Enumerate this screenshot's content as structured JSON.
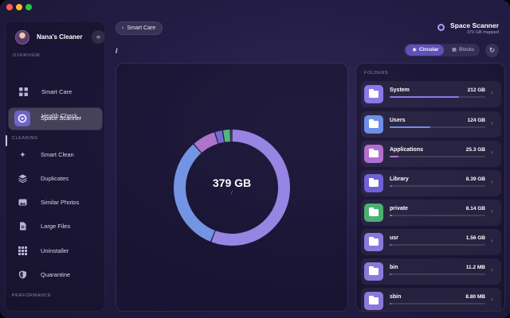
{
  "app": {
    "user_name": "Nana's Cleaner"
  },
  "sidebar": {
    "sections": [
      "OVERVIEW",
      "CLEANING",
      "PERFORMANCE"
    ],
    "items": [
      {
        "label": "Smart Care",
        "icon": "grid-icon"
      },
      {
        "label": "Health Check",
        "icon": "heart-pulse-icon"
      },
      {
        "label": "Space Scanner",
        "icon": "disk-icon",
        "active": true
      },
      {
        "label": "Smart Clean",
        "icon": "sparkle-icon"
      },
      {
        "label": "Duplicates",
        "icon": "stack-icon"
      },
      {
        "label": "Similar Photos",
        "icon": "photos-icon"
      },
      {
        "label": "Large Files",
        "icon": "file-icon"
      },
      {
        "label": "Uninstaller",
        "icon": "apps-grid-icon"
      },
      {
        "label": "Quarantine",
        "icon": "shield-icon"
      }
    ]
  },
  "header": {
    "back_label": "Smart Care",
    "path": "/",
    "title": "Space Scanner",
    "subtitle": "379 GB mapped",
    "view_options": [
      "Circular",
      "Blocks"
    ],
    "selected_view": "Circular"
  },
  "chart": {
    "total": "379 GB",
    "path": "/"
  },
  "chart_data": {
    "type": "pie",
    "categories": [
      "System",
      "Users",
      "Applications",
      "Library",
      "private",
      "usr",
      "bin",
      "sbin"
    ],
    "values": [
      212,
      124,
      25.3,
      8.39,
      8.14,
      1.56,
      0.0112,
      0.0088
    ],
    "units": "GB",
    "colors": [
      "#a08ef0",
      "#7a9ef0",
      "#b97cd6",
      "#7b6fe0",
      "#57c47f",
      "#8f7fe0",
      "#8f7fe0",
      "#8f7fe0"
    ]
  },
  "folders": {
    "title": "FOLDERS",
    "items": [
      {
        "name": "System",
        "size": "212 GB",
        "fraction": 0.56,
        "color": "#8b78e8"
      },
      {
        "name": "Users",
        "size": "124 GB",
        "fraction": 0.33,
        "color": "#6e8fe8"
      },
      {
        "name": "Applications",
        "size": "25.3 GB",
        "fraction": 0.07,
        "color": "#b06fd0"
      },
      {
        "name": "Library",
        "size": "8.39 GB",
        "fraction": 0.02,
        "color": "#6f62d8"
      },
      {
        "name": "private",
        "size": "8.14 GB",
        "fraction": 0.02,
        "color": "#4caf72"
      },
      {
        "name": "usr",
        "size": "1.56 GB",
        "fraction": 0.005,
        "color": "#8a79da"
      },
      {
        "name": "bin",
        "size": "11.2 MB",
        "fraction": 0.0,
        "color": "#8a79da"
      },
      {
        "name": "sbin",
        "size": "8.80 MB",
        "fraction": 0.0,
        "color": "#8a79da"
      }
    ]
  }
}
